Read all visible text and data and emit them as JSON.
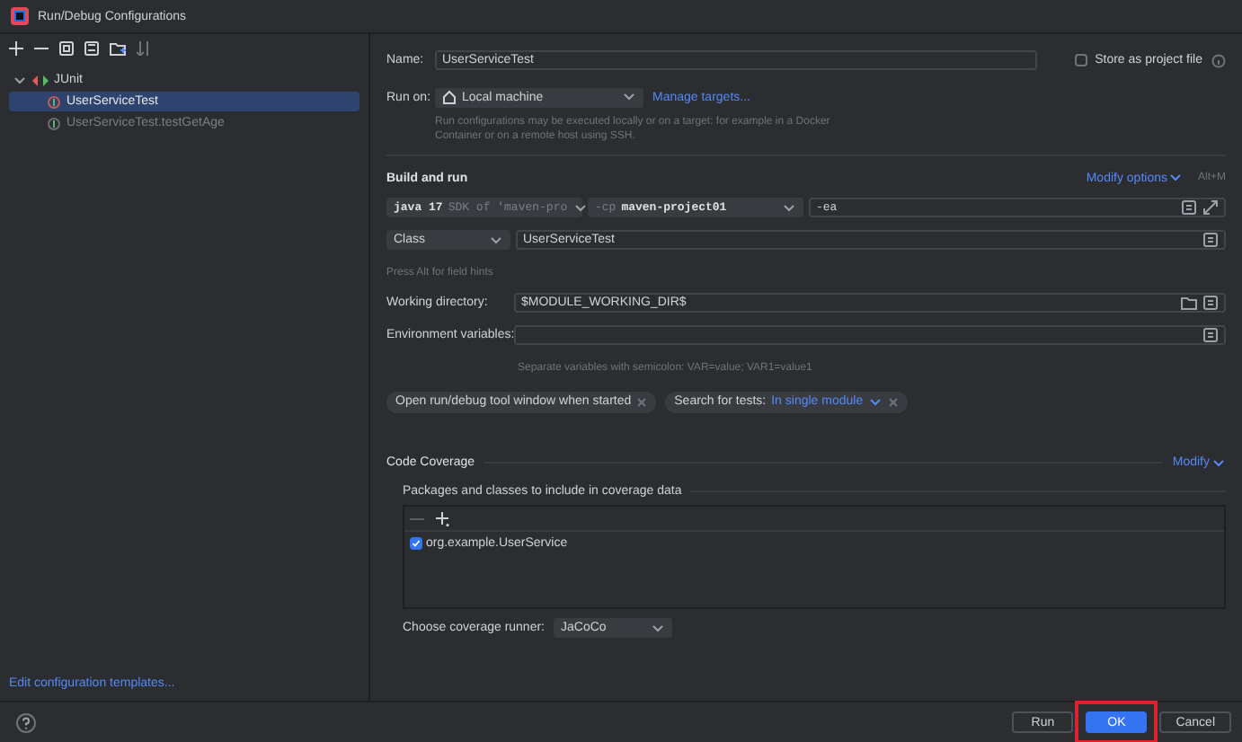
{
  "window": {
    "title": "Run/Debug Configurations"
  },
  "sidebar": {
    "tree": [
      {
        "label": "JUnit",
        "expanded": true,
        "children": [
          {
            "label": "UserServiceTest",
            "selected": true,
            "temporary": false
          },
          {
            "label": "UserServiceTest.testGetAge",
            "selected": false,
            "temporary": true
          }
        ]
      }
    ],
    "footer_link": "Edit configuration templates..."
  },
  "form": {
    "name": {
      "label": "Name:",
      "value": "UserServiceTest"
    },
    "store": {
      "label": "Store as project file",
      "checked": false
    },
    "run_on": {
      "label": "Run on:",
      "value": "Local machine",
      "link": "Manage targets..."
    },
    "run_on_hint": "Run configurations may be executed locally or on a target: for example in a Docker Container or on a remote host using SSH.",
    "section": "Build and run",
    "modify_options": "Modify options",
    "shortcut": "Alt+M",
    "jdk": {
      "name": "java 17",
      "detail": "SDK of 'maven-pro"
    },
    "classpath": {
      "prefix": "-cp",
      "value": "maven-project01"
    },
    "vm_options": "-ea",
    "test_kind": "Class",
    "class_value": "UserServiceTest",
    "field_hint": "Press Alt for field hints",
    "working_dir": {
      "label": "Working directory:",
      "value": "$MODULE_WORKING_DIR$"
    },
    "env": {
      "label": "Environment variables:"
    },
    "env_hint": "Separate variables with semicolon: VAR=value; VAR1=value1",
    "chips": [
      {
        "label": "Open run/debug tool window when started"
      },
      {
        "label": "Search for tests:",
        "value": "In single module"
      }
    ]
  },
  "coverage": {
    "title": "Code Coverage",
    "modify": "Modify",
    "packages_label": "Packages and classes to include in coverage data",
    "entries": [
      {
        "label": "org.example.UserService",
        "checked": true
      }
    ],
    "runner_label": "Choose coverage runner:",
    "runner_value": "JaCoCo"
  },
  "buttons": [
    {
      "label": "Run",
      "kind": "default",
      "highlighted": false
    },
    {
      "label": "OK",
      "kind": "primary",
      "highlighted": true
    },
    {
      "label": "Cancel",
      "kind": "default",
      "highlighted": false
    }
  ]
}
